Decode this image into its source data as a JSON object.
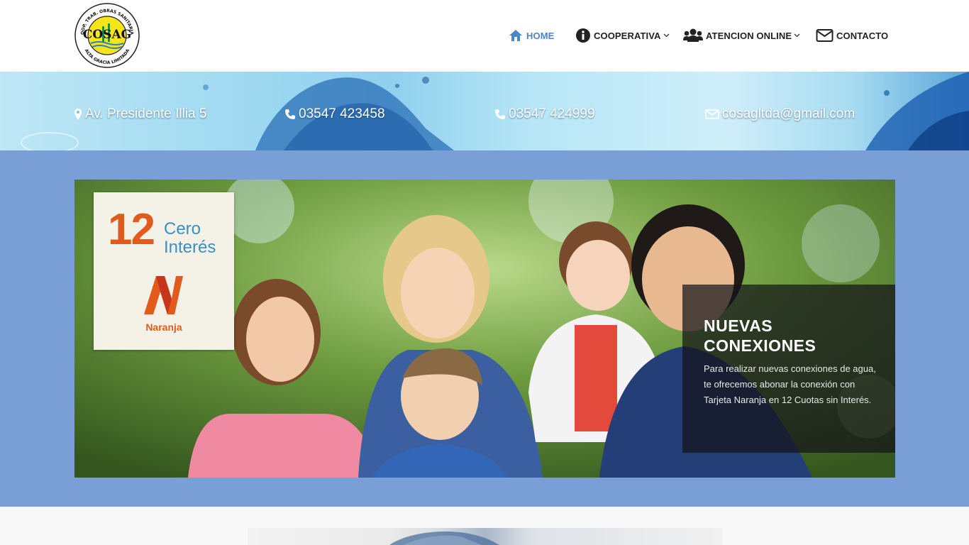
{
  "header": {
    "nav": [
      {
        "label": "HOME",
        "icon": "home-icon",
        "active": true
      },
      {
        "label": "COOPERATIVA",
        "icon": "info-circle-icon",
        "dropdown": true
      },
      {
        "label": "ATENCION ONLINE",
        "icon": "users-icon",
        "dropdown": true
      },
      {
        "label": "CONTACTO",
        "icon": "envelope-icon"
      }
    ]
  },
  "logo": {
    "ring_top": "COOP. TRAB. OBRAS SANITARIAS",
    "ring_bottom": "ALTA GRACIA LIMITADA",
    "center": "COSAG"
  },
  "contact_band": {
    "address": "Av. Presidente Illia 5",
    "phone1": "03547 423458",
    "phone2": "03547 424999",
    "email": "cosagltda@gmail.com"
  },
  "slide": {
    "promo": {
      "number": "12",
      "line1": "Cero",
      "line2": "Interés",
      "brand": "Naranja"
    },
    "caption": {
      "title": "NUEVAS CONEXIONES",
      "text": "Para realizar nuevas conexiones de agua, te ofrecemos abonar la conexión con Tarjeta Naranja en 12 Cuotas sin Interés."
    }
  },
  "colors": {
    "accent": "#4a86c8",
    "slider_background": "#7a9fd6",
    "promo_orange": "#e25a1c",
    "promo_blue": "#3a8fc6"
  }
}
